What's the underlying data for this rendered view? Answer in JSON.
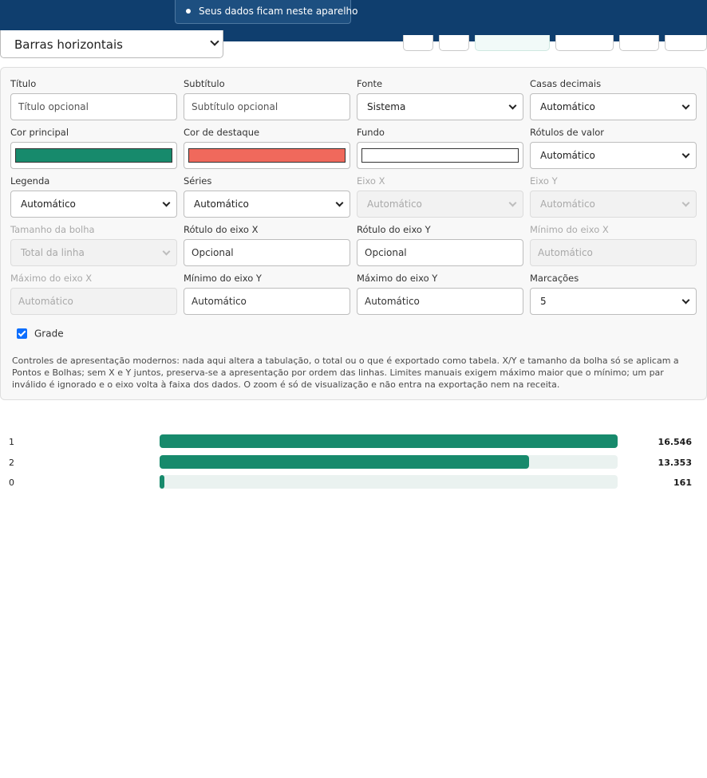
{
  "header": {
    "privacy_notice": "Seus dados ficam neste aparelho"
  },
  "chart_type_select": {
    "value": "Barras horizontais"
  },
  "colors": {
    "header_bg": "#0f3e6e",
    "principal": "#178a6c",
    "destaque": "#f0695c",
    "fundo": "#ffffff",
    "bar_track": "#eaf2f0"
  },
  "form": {
    "titulo": {
      "label": "Título",
      "placeholder": "Título opcional"
    },
    "subtitulo": {
      "label": "Subtítulo",
      "placeholder": "Subtítulo opcional"
    },
    "fonte": {
      "label": "Fonte",
      "value": "Sistema"
    },
    "casas_decimais": {
      "label": "Casas decimais",
      "value": "Automático"
    },
    "cor_principal": {
      "label": "Cor principal"
    },
    "cor_destaque": {
      "label": "Cor de destaque"
    },
    "fundo": {
      "label": "Fundo"
    },
    "rotulos_valor": {
      "label": "Rótulos de valor",
      "value": "Automático"
    },
    "legenda": {
      "label": "Legenda",
      "value": "Automático"
    },
    "series": {
      "label": "Séries",
      "value": "Automático"
    },
    "eixo_x": {
      "label": "Eixo X",
      "value": "Automático"
    },
    "eixo_y": {
      "label": "Eixo Y",
      "value": "Automático"
    },
    "tamanho_bolha": {
      "label": "Tamanho da bolha",
      "value": "Total da linha"
    },
    "rotulo_eixo_x": {
      "label": "Rótulo do eixo X",
      "value": "Opcional"
    },
    "rotulo_eixo_y": {
      "label": "Rótulo do eixo Y",
      "value": "Opcional"
    },
    "minimo_eixo_x": {
      "label": "Mínimo do eixo X",
      "placeholder": "Automático"
    },
    "maximo_eixo_x": {
      "label": "Máximo do eixo X",
      "placeholder": "Automático"
    },
    "minimo_eixo_y": {
      "label": "Mínimo do eixo Y",
      "value": "Automático"
    },
    "maximo_eixo_y": {
      "label": "Máximo do eixo Y",
      "value": "Automático"
    },
    "marcacoes": {
      "label": "Marcações",
      "value": "5"
    },
    "grade": {
      "label": "Grade",
      "checked": true
    }
  },
  "help_text": "Controles de apresentação modernos: nada aqui altera a tabulação, o total ou o que é exportado como tabela. X/Y e tamanho da bolha só se aplicam a Pontos e Bolhas; sem X e Y juntos, preserva-se a apresentação por ordem das linhas. Limites manuais exigem máximo maior que o mínimo; um par inválido é ignorado e o eixo volta à faixa dos dados. O zoom é só de visualização e não entra na exportação nem na receita.",
  "chart_data": {
    "type": "bar",
    "orientation": "horizontal",
    "categories": [
      "1",
      "2",
      "0"
    ],
    "values": [
      16546,
      13353,
      161
    ],
    "value_labels": [
      "16.546",
      "13.353",
      "161"
    ],
    "xlim": [
      0,
      16546
    ],
    "grid": false,
    "legend": "none"
  }
}
